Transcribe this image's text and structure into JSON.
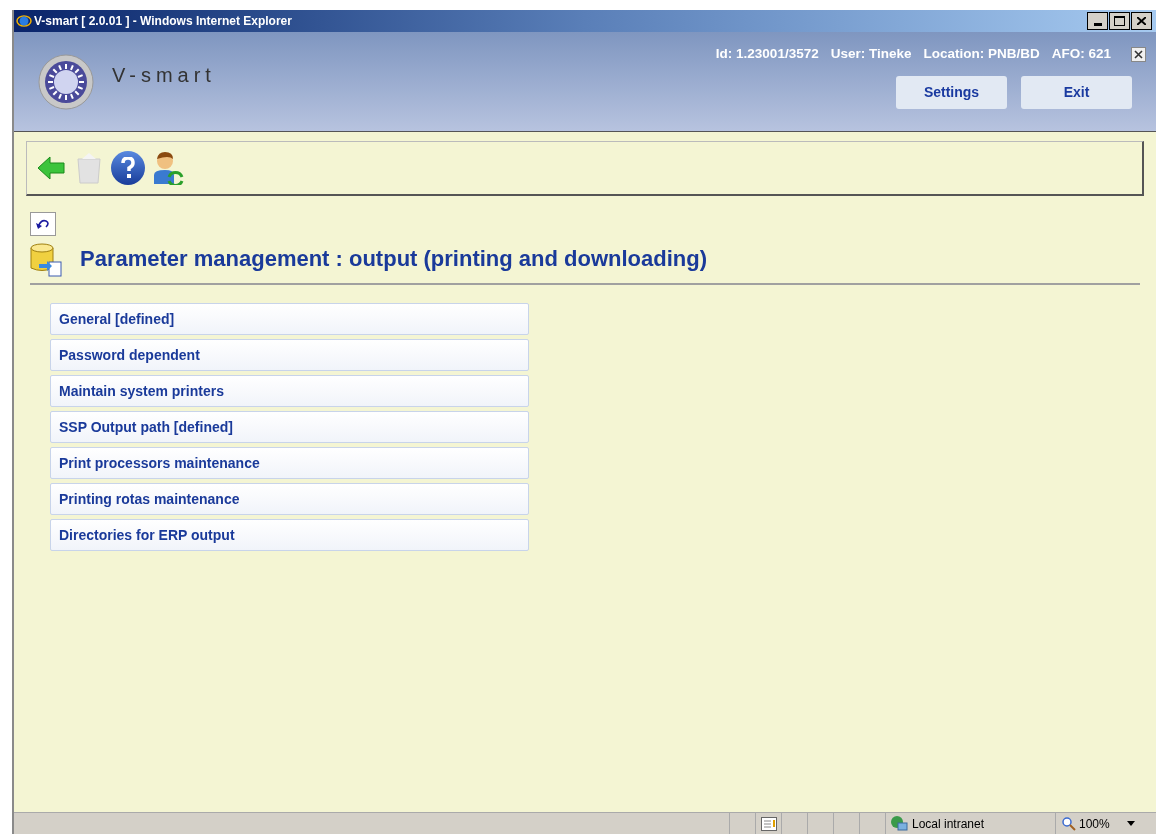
{
  "window": {
    "title": "V-smart [ 2.0.01 ] - Windows Internet Explorer"
  },
  "header": {
    "logo_text": "V-smart",
    "info": [
      "Id: 1.23001/3572",
      "User: Tineke",
      "Location: PNB/BD",
      "AFO: 621"
    ],
    "buttons": [
      "Settings",
      "Exit"
    ]
  },
  "page": {
    "title": "Parameter management : output (printing and downloading)"
  },
  "menu_items": [
    "General [defined]",
    "Password dependent",
    "Maintain system printers",
    "SSP Output path [defined]",
    "Print processors maintenance",
    "Printing rotas maintenance",
    "Directories for ERP output"
  ],
  "status_bar": {
    "zone": "Local intranet",
    "zoom": "100%"
  }
}
